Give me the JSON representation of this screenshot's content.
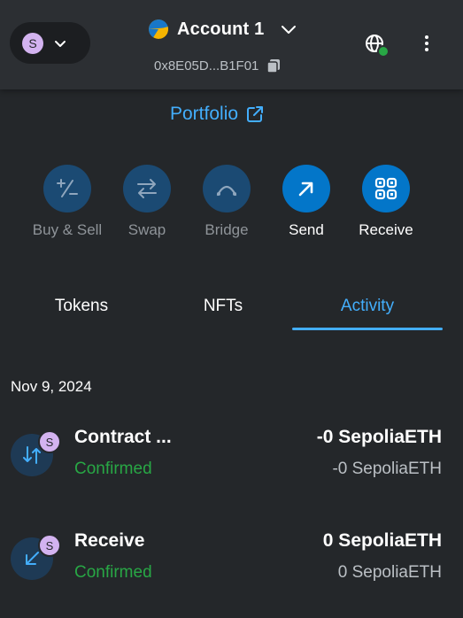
{
  "header": {
    "network_avatar_letter": "S",
    "account_name": "Account 1",
    "address": "0x8E05D...B1F01"
  },
  "portfolio": {
    "label": "Portfolio"
  },
  "actions": [
    {
      "label": "Buy & Sell",
      "enabled": false
    },
    {
      "label": "Swap",
      "enabled": false
    },
    {
      "label": "Bridge",
      "enabled": false
    },
    {
      "label": "Send",
      "enabled": true
    },
    {
      "label": "Receive",
      "enabled": true
    }
  ],
  "tabs": [
    {
      "label": "Tokens",
      "active": false
    },
    {
      "label": "NFTs",
      "active": false
    },
    {
      "label": "Activity",
      "active": true
    }
  ],
  "activity": {
    "date": "Nov 9, 2024",
    "transactions": [
      {
        "title": "Contract ...",
        "status": "Confirmed",
        "primary_amount": "-0 SepoliaETH",
        "secondary_amount": "-0 SepoliaETH",
        "badge": "S",
        "icon": "contract-interaction-icon"
      },
      {
        "title": "Receive",
        "status": "Confirmed",
        "primary_amount": "0 SepoliaETH",
        "secondary_amount": "0 SepoliaETH",
        "badge": "S",
        "icon": "receive-arrow-icon"
      }
    ]
  },
  "colors": {
    "background": "#24272a",
    "accent": "#43aefc",
    "primary_button": "#0376c9",
    "disabled_button": "#1b4a73",
    "success": "#28a745",
    "network_badge": "#d3b3f0"
  }
}
